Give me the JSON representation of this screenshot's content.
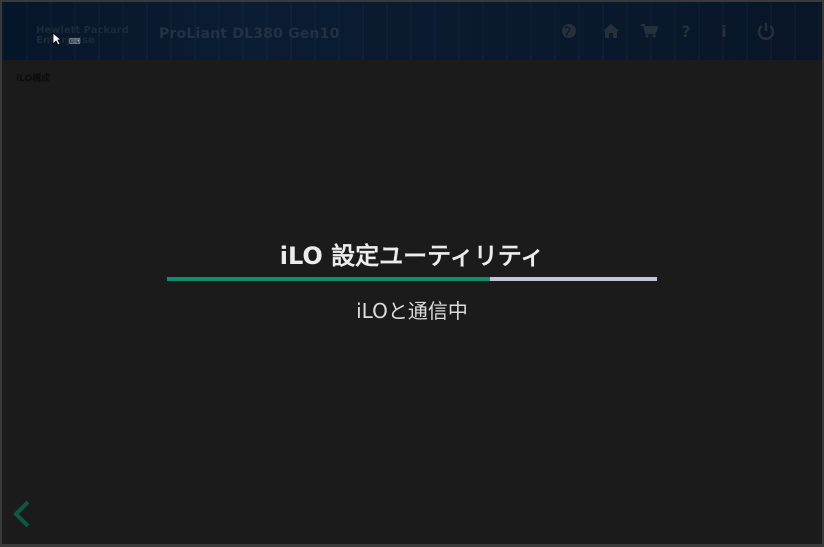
{
  "header": {
    "brand_line1": "Hewlett Packard",
    "brand_line2": "Enterprise",
    "product": "ProLiant DL380 Gen10",
    "icons": [
      "globe-icon",
      "home-icon",
      "cart-icon",
      "help-icon",
      "info-icon",
      "power-icon"
    ],
    "help_glyph": "?",
    "info_glyph": "i"
  },
  "breadcrumb": "iLO構成",
  "dialog": {
    "title": "iLO 設定ユーティリティ",
    "status": "iLOと通信中",
    "progress_fraction": 0.66,
    "progress_color": "#0e8f6c",
    "progress_track_color": "#c3c3d9"
  },
  "nav": {
    "back_glyph": "‹"
  }
}
